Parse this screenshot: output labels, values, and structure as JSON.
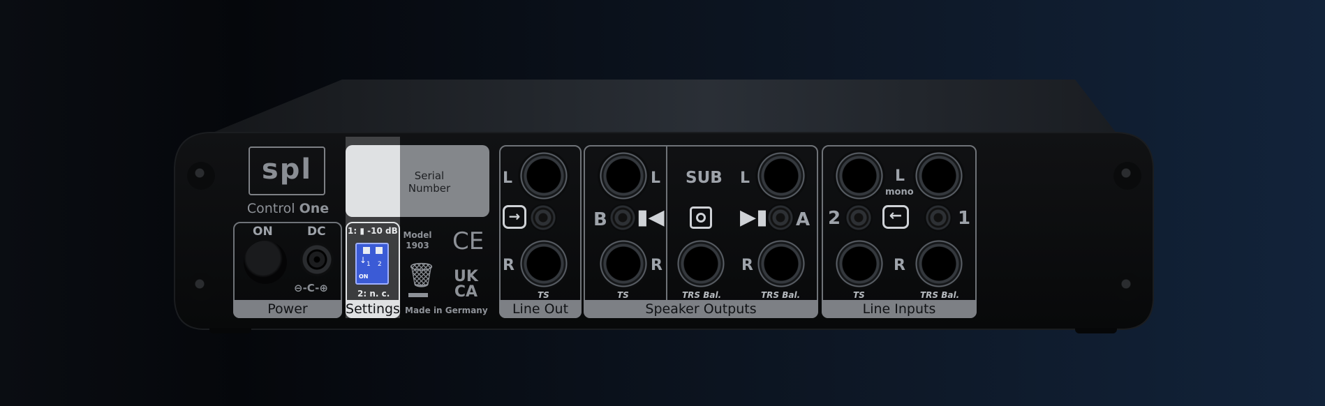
{
  "device": {
    "brand": "spl",
    "model_name_left": "Control",
    "model_name_right": "One"
  },
  "serial": {
    "line1": "Serial",
    "line2": "Number"
  },
  "power": {
    "on_label": "ON",
    "dc_label": "DC",
    "polarity_symbol": "⊖-C-⊕",
    "section_label": "Power"
  },
  "settings": {
    "switch1_label": "1:",
    "switch1_value": "-10 dB",
    "dip_num1": "1",
    "dip_num2": "2",
    "dip_on": "ON",
    "switch2_label": "2: n. c.",
    "section_label": "Settings"
  },
  "model": {
    "line1": "Model",
    "line2": "1903",
    "made_in": "Made in Germany",
    "ce_mark": "CE",
    "ukca_line1": "UK",
    "ukca_line2": "CA"
  },
  "line_out": {
    "left": "L",
    "right": "R",
    "type": "TS",
    "section_label": "Line Out"
  },
  "speaker_outputs": {
    "left_label": "L",
    "right_label": "R",
    "b_label": "B",
    "a_label": "A",
    "sub_label": "SUB",
    "l2_label": "L",
    "r2_label": "R",
    "type_b": "TS",
    "type_sub": "TRS Bal.",
    "type_a": "TRS Bal.",
    "section_label": "Speaker Outputs"
  },
  "line_inputs": {
    "left_label": "L",
    "mono_label": "mono",
    "right_label": "R",
    "in2_label": "2",
    "in1_label": "1",
    "type_2": "TS",
    "type_1": "TRS Bal.",
    "section_label": "Line Inputs"
  },
  "colors": {
    "panel": "#0c0d0f",
    "label_gray": "#7d8085",
    "dip_blue": "#3b5bd6"
  }
}
